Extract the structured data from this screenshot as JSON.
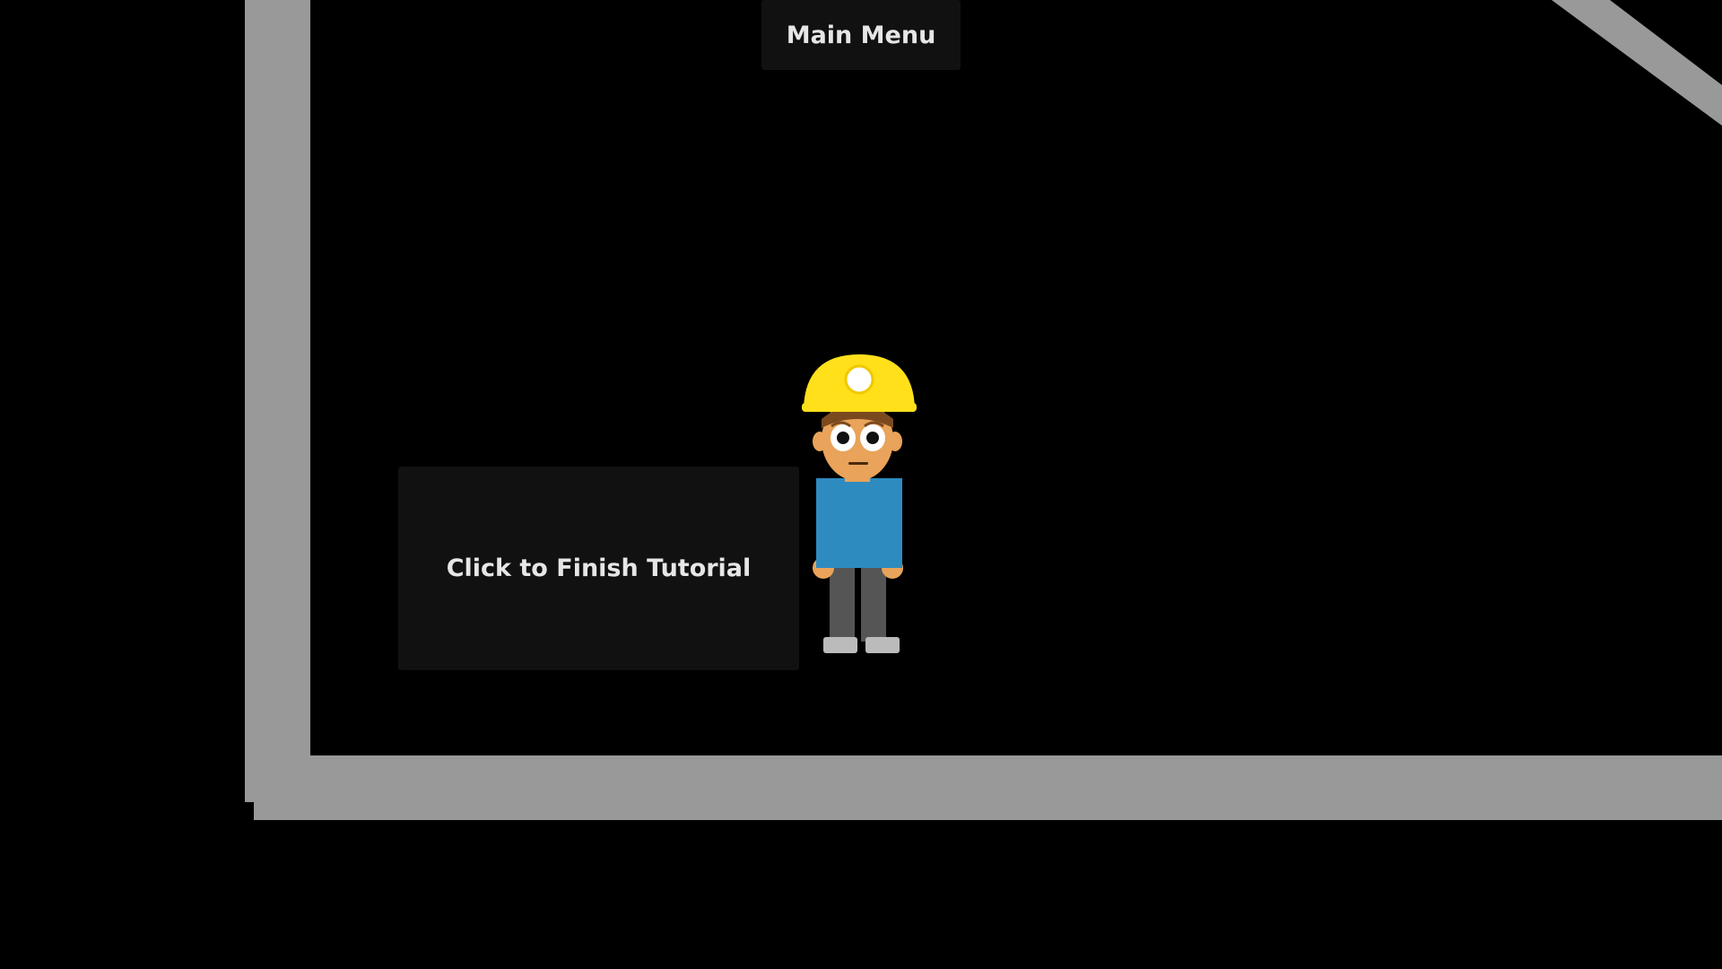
{
  "game": {
    "main_menu_label": "Main Menu",
    "finish_tutorial_label": "Click to Finish Tutorial"
  },
  "colors": {
    "background": "#000000",
    "wall": "#999999",
    "button_bg": "#111111",
    "button_text": "#e6e6e6",
    "helmet": "#ffe01a",
    "shirt": "#2e8bc0",
    "pants": "#555555",
    "skin": "#e9a35a",
    "hair": "#7a4a1e"
  },
  "icons": {
    "character": "miner-character-icon"
  }
}
